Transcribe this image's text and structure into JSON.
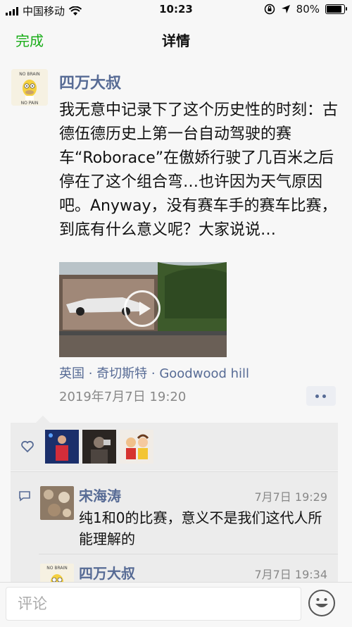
{
  "status": {
    "carrier": "中国移动",
    "time": "10:23",
    "battery": "80%"
  },
  "nav": {
    "done_label": "完成",
    "title": "详情"
  },
  "post": {
    "author": "四万大叔",
    "text": "我无意中记录下了这个历史性的时刻：古德伍德历史上第一台自动驾驶的赛车“Roborace”在傲娇行驶了几百米之后停在了这个组合弯…也许因为天气原因吧。Anyway，没有赛车手的赛车比赛，到底有什么意义呢？大家说说…",
    "location": "英国 · 奇切斯特 · Goodwood hill",
    "timestamp": "2019年7月7日 19:20"
  },
  "likes": {
    "count_shown": 3
  },
  "comments": [
    {
      "name": "宋海涛",
      "time": "7月7日 19:29",
      "text": "纯1和0的比赛，意义不是我们这代人所能理解的"
    },
    {
      "name": "四万大叔",
      "time": "7月7日 19:34",
      "text": ""
    }
  ],
  "input": {
    "placeholder": "评论"
  },
  "colors": {
    "accent": "#1aad19",
    "name_link": "#576b95"
  }
}
